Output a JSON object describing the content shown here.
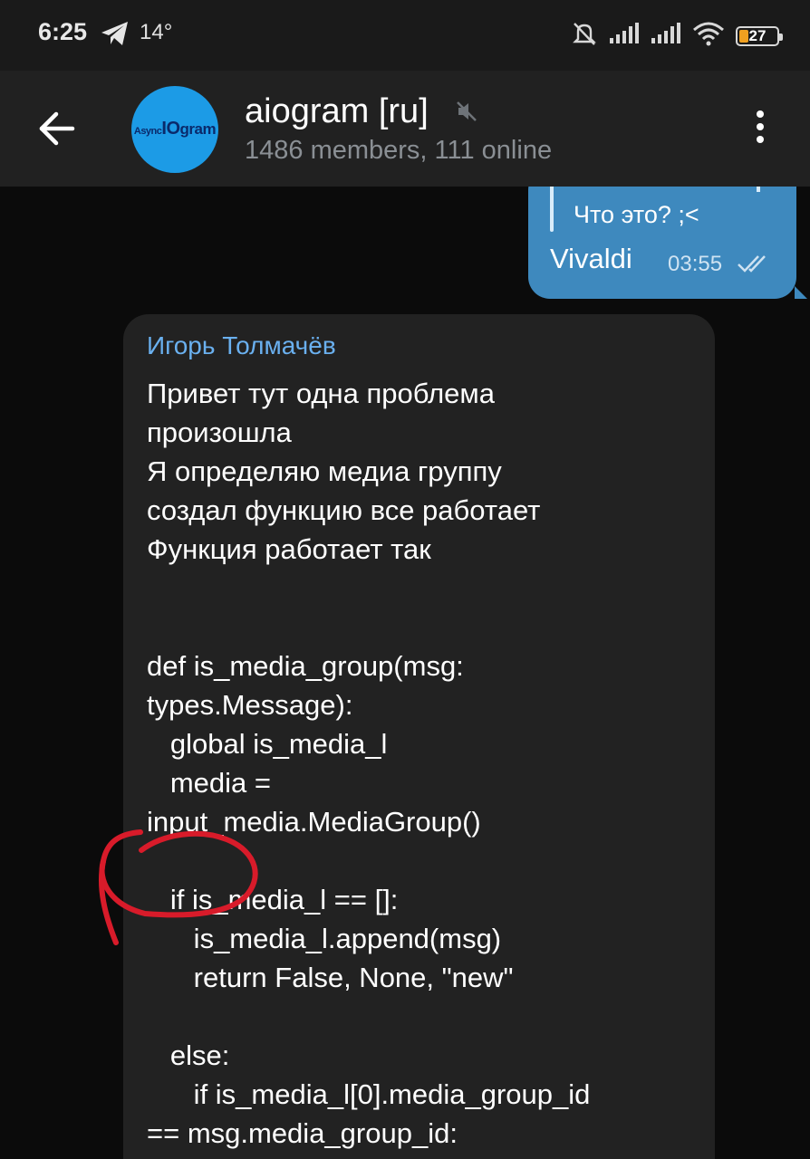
{
  "status_bar": {
    "time": "6:25",
    "temperature": "14°",
    "battery": "27",
    "icons": [
      "telegram-icon",
      "mute-alarm-icon",
      "signal-icon",
      "signal-icon",
      "wifi-icon",
      "battery-icon"
    ]
  },
  "header": {
    "title": "aiogram [ru]",
    "subtitle": "1486 members, 111 online",
    "avatar_text_small": "Async",
    "avatar_text_io": "IO",
    "avatar_text_gram": "gram",
    "colors": {
      "header_bg": "#212121",
      "avatar_bg": "#1c9be6"
    }
  },
  "messages": {
    "outgoing": {
      "reply_text": "Что это? ;<",
      "text": "Vivaldi",
      "time": "03:55",
      "status": "read",
      "bubble_color": "#3e89be"
    },
    "incoming": {
      "sender": "Игорь Толмачёв",
      "text": "Привет тут одна проблема\nпроизошла\nЯ определяю медиа группу\nсоздал функцию все работает\nФункция работает так\n\n\ndef is_media_group(msg:\ntypes.Message):\n   global is_media_l\n   media =\ninput_media.MediaGroup()\n\n   if is_media_l == []:\n      is_media_l.append(msg)\n      return False, None, \"new\"\n\n   else:\n      if is_media_l[0].media_group_id\n== msg.media_group_id:",
      "sender_color": "#6ab0ef",
      "bubble_color": "#222222"
    }
  },
  "annotation": {
    "color": "#d81b2a"
  }
}
